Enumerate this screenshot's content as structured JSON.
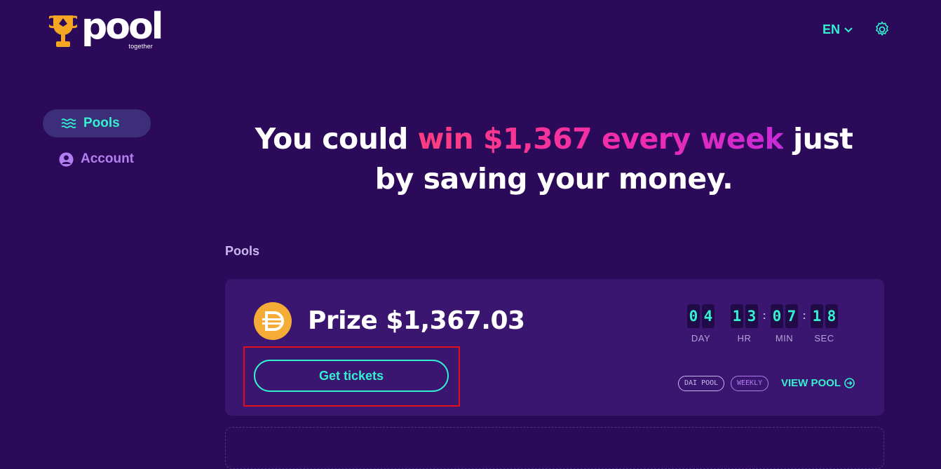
{
  "brand": {
    "logo_word": "pool",
    "logo_sub": "together"
  },
  "header": {
    "language": "EN",
    "colors": {
      "accent": "#35f0d0",
      "background": "#2b0b59"
    }
  },
  "sidebar": {
    "items": [
      {
        "label": "Pools",
        "icon": "waves-icon",
        "active": true
      },
      {
        "label": "Account",
        "icon": "user-circle-icon",
        "active": false
      }
    ]
  },
  "hero": {
    "prefix": "You could",
    "accent": "win $1,367 every week",
    "suffix": "just by saving your money."
  },
  "pools_section": {
    "title": "Pools"
  },
  "pool_card": {
    "token_icon": "dai-icon",
    "prize_label": "Prize $1,367.03",
    "get_tickets_label": "Get tickets",
    "countdown": {
      "day": [
        "0",
        "4"
      ],
      "hr": [
        "1",
        "3"
      ],
      "min": [
        "0",
        "7"
      ],
      "sec": [
        "1",
        "8"
      ],
      "labels": {
        "day": "DAY",
        "hr": "HR",
        "min": "MIN",
        "sec": "SEC"
      },
      "separator": ":"
    },
    "tags": {
      "pool": "DAI POOL",
      "frequency": "WEEKLY"
    },
    "view_pool_label": "VIEW POOL"
  }
}
